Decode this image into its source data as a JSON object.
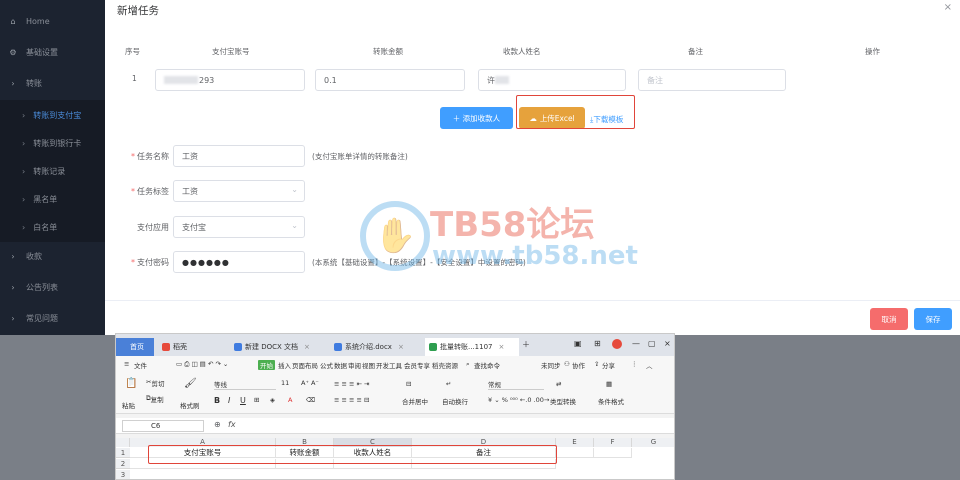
{
  "sidebar": {
    "items": [
      {
        "icon": "home-icon",
        "label": "Home"
      },
      {
        "icon": "settings-icon",
        "label": "基础设置"
      },
      {
        "icon": "chevron-right-icon",
        "label": "转账"
      },
      {
        "label": "转账到支付宝"
      },
      {
        "label": "转账到银行卡"
      },
      {
        "label": "转账记录"
      },
      {
        "label": "黑名单"
      },
      {
        "label": "白名单"
      },
      {
        "icon": "chevron-right-icon",
        "label": "收款"
      },
      {
        "icon": "chevron-right-icon",
        "label": "公告列表"
      },
      {
        "icon": "chevron-right-icon",
        "label": "常见问题"
      }
    ]
  },
  "dialog": {
    "title": "新增任务",
    "close": "×",
    "columns": [
      "序号",
      "支付宝账号",
      "转账金额",
      "收款人姓名",
      "备注",
      "操作"
    ],
    "row": {
      "index": "1",
      "account_suffix": "293",
      "amount": "0.1",
      "name_prefix": "许",
      "remark_placeholder": "备注"
    },
    "add_payee_button": "＋ 添加收款人",
    "upload_button": "上传Excel",
    "download_link": "⤓下载模板",
    "form": {
      "task_name_label": "任务名称",
      "task_name_value": "工资",
      "task_name_hint": "(支付宝账单详情的转账备注)",
      "task_tag_label": "任务标签",
      "task_tag_value": "工资",
      "pay_app_label": "支付应用",
      "pay_app_value": "支付宝",
      "pay_pwd_label": "支付密码",
      "pay_pwd_value": "●●●●●●",
      "pay_pwd_hint": "(本系统【基础设置】-【系统设置】-【安全设置】中设置的密码)"
    },
    "cancel_button": "取消",
    "save_button": "保存"
  },
  "watermark": {
    "text": "TB58论坛",
    "url": "www.tb58.net"
  },
  "spreadsheet": {
    "tabs": [
      {
        "label": "首页"
      },
      {
        "label": "稻壳"
      },
      {
        "label": "新建 DOCX 文档"
      },
      {
        "label": "系统介绍.docx"
      },
      {
        "label": "批量转账...1107"
      }
    ],
    "menu": [
      "文件",
      "开始",
      "插入",
      "页面布局",
      "公式",
      "数据",
      "审阅",
      "视图",
      "开发工具",
      "会员专享",
      "稻壳资源",
      "查找命令",
      "未同步",
      "协作",
      "分享"
    ],
    "ribbon": {
      "paste": "粘贴",
      "cut": "剪切",
      "copy": "复制",
      "format_painter": "格式刷",
      "font": "等线",
      "font_size": "11",
      "merge": "合并居中",
      "wrap": "自动换行",
      "number_format": "常规",
      "type_convert": "类型转换",
      "conditional": "条件格式"
    },
    "cell_ref": "C6",
    "fx": "fx",
    "col_headers": [
      "A",
      "B",
      "C",
      "D",
      "E",
      "F",
      "G"
    ],
    "row_headers": [
      "1",
      "2",
      "3"
    ],
    "header_row": [
      "支付宝账号",
      "转账金额",
      "收款人姓名",
      "备注"
    ]
  }
}
